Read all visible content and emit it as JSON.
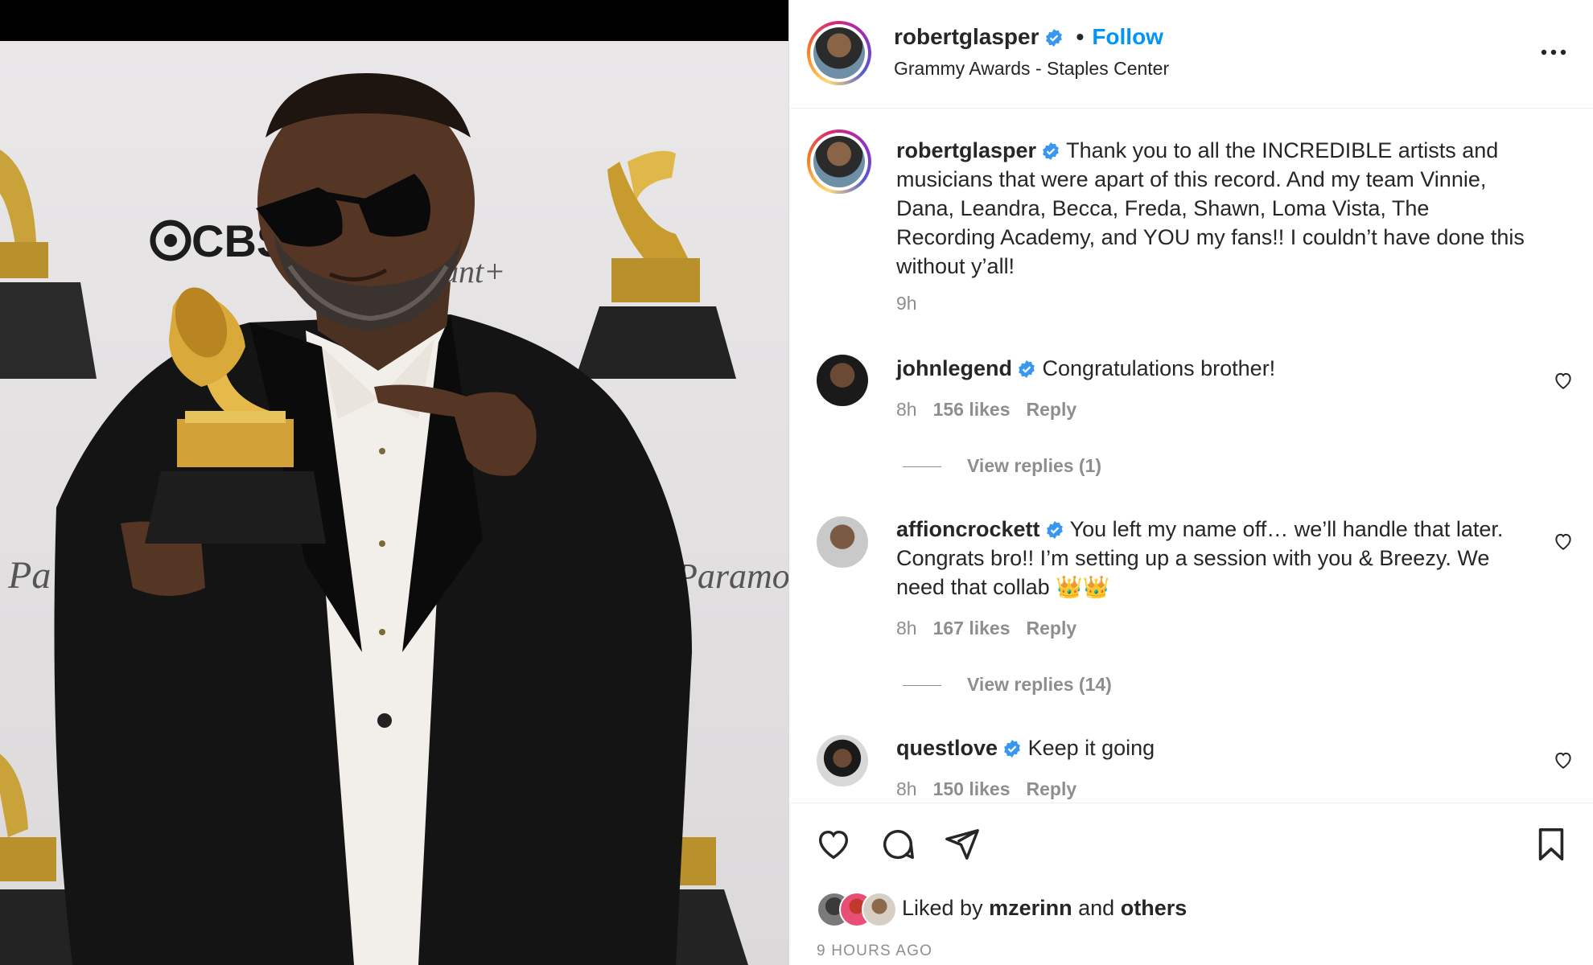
{
  "post": {
    "author": "robertglasper",
    "follow_label": "Follow",
    "separator": "•",
    "location": "Grammy Awards - Staples Center"
  },
  "photo": {
    "backdrop_texts": [
      "CBS",
      "ount+",
      "Pa",
      "Paramou"
    ]
  },
  "caption": {
    "username": "robertglasper",
    "text": "Thank you to all the INCREDIBLE artists and musicians that were apart of this record. And my team Vinnie, Dana, Leandra, Becca, Freda, Shawn, Loma Vista, The Recording Academy, and YOU my fans!! I couldn’t have done this without y’all!",
    "time": "9h"
  },
  "comments": [
    {
      "username": "johnlegend",
      "text": "Congratulations brother!",
      "time": "8h",
      "likes": "156 likes",
      "reply": "Reply",
      "view_replies": "View replies (1)"
    },
    {
      "username": "affioncrockett",
      "text": "You left my name off… we’ll handle that later. Congrats bro!! I’m setting up a session with you & Breezy. We need that collab 👑👑",
      "time": "8h",
      "likes": "167 likes",
      "reply": "Reply",
      "view_replies": "View replies (14)"
    },
    {
      "username": "questlove",
      "text": "Keep it going",
      "time": "8h",
      "likes": "150 likes",
      "reply": "Reply"
    }
  ],
  "footer": {
    "liked_prefix": "Liked by",
    "liked_user": "mzerinn",
    "liked_and": "and",
    "liked_others": "others",
    "timestamp": "9 HOURS AGO"
  },
  "icons": {
    "more": "more-horizontal-icon",
    "verified": "verified-badge-icon",
    "like": "heart-icon",
    "comment": "comment-icon",
    "share": "send-icon",
    "save": "bookmark-icon"
  },
  "colors": {
    "accent": "#0095f6",
    "muted": "#8e8e8e",
    "text": "#262626",
    "verified": "#3897f0"
  }
}
